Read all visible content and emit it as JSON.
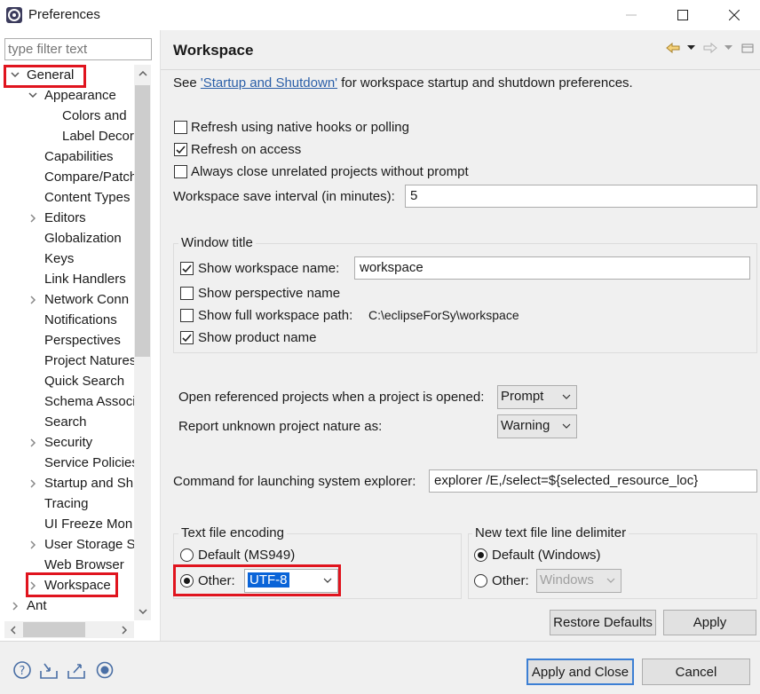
{
  "window": {
    "title": "Preferences"
  },
  "filter": {
    "placeholder": "type filter text"
  },
  "tree": {
    "items": [
      {
        "label": "General",
        "twisty": "open"
      },
      {
        "label": "Appearance",
        "twisty": "open"
      },
      {
        "label": "Colors and",
        "twisty": "none"
      },
      {
        "label": "Label Decor",
        "twisty": "none"
      },
      {
        "label": "Capabilities",
        "twisty": "none"
      },
      {
        "label": "Compare/Patch",
        "twisty": "none"
      },
      {
        "label": "Content Types",
        "twisty": "none"
      },
      {
        "label": "Editors",
        "twisty": "closed"
      },
      {
        "label": "Globalization",
        "twisty": "none"
      },
      {
        "label": "Keys",
        "twisty": "none"
      },
      {
        "label": "Link Handlers",
        "twisty": "none"
      },
      {
        "label": "Network Conn",
        "twisty": "closed"
      },
      {
        "label": "Notifications",
        "twisty": "none"
      },
      {
        "label": "Perspectives",
        "twisty": "none"
      },
      {
        "label": "Project Natures",
        "twisty": "none"
      },
      {
        "label": "Quick Search",
        "twisty": "none"
      },
      {
        "label": "Schema Associ",
        "twisty": "none"
      },
      {
        "label": "Search",
        "twisty": "none"
      },
      {
        "label": "Security",
        "twisty": "closed"
      },
      {
        "label": "Service Policies",
        "twisty": "none"
      },
      {
        "label": "Startup and Sh",
        "twisty": "closed"
      },
      {
        "label": "Tracing",
        "twisty": "none"
      },
      {
        "label": "UI Freeze Mon",
        "twisty": "none"
      },
      {
        "label": "User Storage S",
        "twisty": "closed"
      },
      {
        "label": "Web Browser",
        "twisty": "none"
      },
      {
        "label": "Workspace",
        "twisty": "closed"
      },
      {
        "label": "Ant",
        "twisty": "closed"
      }
    ]
  },
  "page": {
    "title": "Workspace",
    "intro_prefix": "See ",
    "intro_link": "'Startup and Shutdown'",
    "intro_suffix": " for workspace startup and shutdown preferences.",
    "refresh_native": {
      "label": "Refresh using native hooks or polling",
      "checked": false
    },
    "refresh_access": {
      "label": "Refresh on access",
      "checked": true
    },
    "always_close": {
      "label": "Always close unrelated projects without prompt",
      "checked": false
    },
    "save_interval": {
      "label": "Workspace save interval (in minutes):",
      "value": "5"
    },
    "window_title": {
      "legend": "Window title",
      "show_name": {
        "label": "Show workspace name:",
        "checked": true,
        "value": "workspace"
      },
      "show_perspective": {
        "label": "Show perspective name",
        "checked": false
      },
      "show_full_path": {
        "label": "Show full workspace path:",
        "checked": false,
        "path": "C:\\eclipseForSy\\workspace"
      },
      "show_product": {
        "label": "Show product name",
        "checked": true
      }
    },
    "open_referenced": {
      "label": "Open referenced projects when a project is opened:",
      "value": "Prompt"
    },
    "report_unknown": {
      "label": "Report unknown project nature as:",
      "value": "Warning"
    },
    "explorer_cmd": {
      "label": "Command for launching system explorer:",
      "value": "explorer /E,/select=${selected_resource_loc}"
    },
    "encoding": {
      "legend": "Text file encoding",
      "default_label": "Default (MS949)",
      "other_label": "Other:",
      "selected": "other",
      "other_value": "UTF-8"
    },
    "line_delimiter": {
      "legend": "New text file line delimiter",
      "default_label": "Default (Windows)",
      "other_label": "Other:",
      "selected": "default",
      "other_value": "Windows"
    }
  },
  "buttons": {
    "restore_defaults": "Restore Defaults",
    "apply": "Apply",
    "apply_close": "Apply and Close",
    "cancel": "Cancel"
  },
  "icons": {
    "help": "help-icon",
    "import": "import-icon",
    "export": "export-icon",
    "record": "oomph-record-icon"
  },
  "colors": {
    "highlight_box": "#e0141e",
    "link": "#2b5fa8",
    "selection": "#0a64d8",
    "primary_border": "#3c7fd4"
  }
}
